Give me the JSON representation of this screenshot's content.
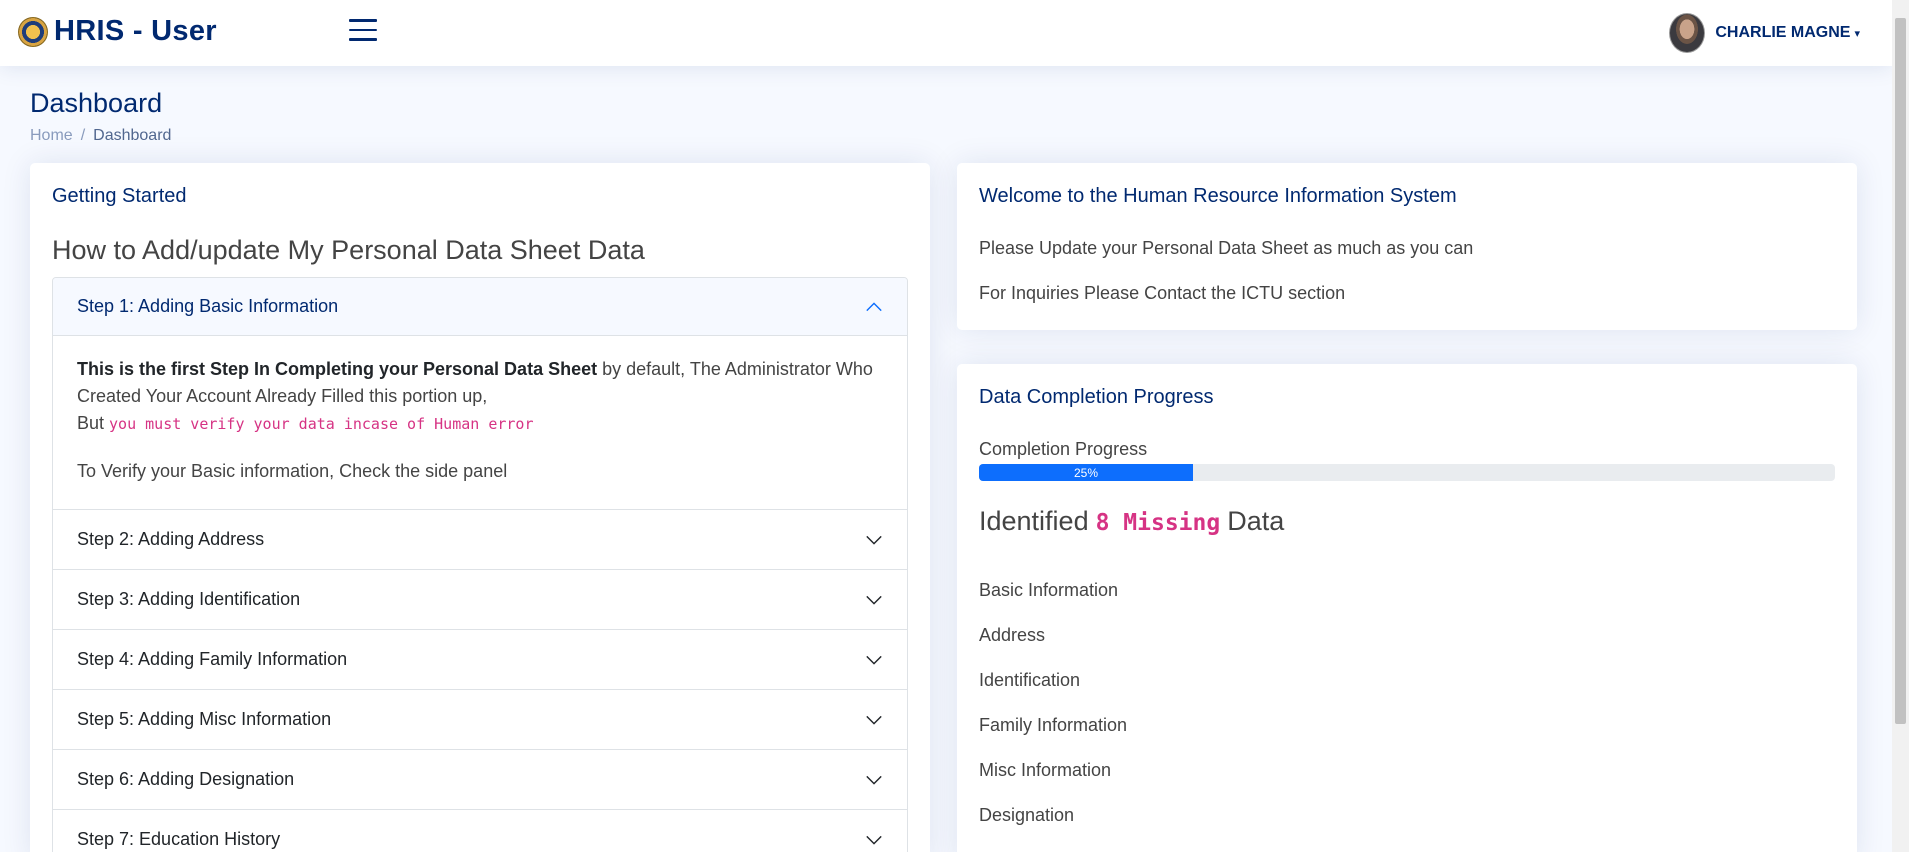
{
  "header": {
    "app_title": "HRIS - User",
    "user_name": "CHARLIE MAGNE",
    "caret": "▾"
  },
  "page": {
    "title": "Dashboard",
    "breadcrumb": {
      "home": "Home",
      "separator": "/",
      "current": "Dashboard"
    }
  },
  "getting_started": {
    "card_title": "Getting Started",
    "heading": "How to Add/update My Personal Data Sheet Data",
    "steps": [
      {
        "label": "Step 1: Adding Basic Information",
        "expanded": true
      },
      {
        "label": "Step 2: Adding Address",
        "expanded": false
      },
      {
        "label": "Step 3: Adding Identification",
        "expanded": false
      },
      {
        "label": "Step 4: Adding Family Information",
        "expanded": false
      },
      {
        "label": "Step 5: Adding Misc Information",
        "expanded": false
      },
      {
        "label": "Step 6: Adding Designation",
        "expanded": false
      },
      {
        "label": "Step 7: Education History",
        "expanded": false
      }
    ],
    "step1_body": {
      "bold": "This is the first Step In Completing your Personal Data Sheet",
      "rest": " by default, The Administrator Who Created Your Account Already Filled this portion up,",
      "but_prefix": "But ",
      "code_text": "you must verify your data incase of Human error",
      "verify_text": "To Verify your Basic information, Check the side panel"
    }
  },
  "welcome": {
    "card_title": "Welcome to the Human Resource Information System",
    "line1": "Please Update your Personal Data Sheet as much as you can",
    "line2": "For Inquiries Please Contact the ICTU section"
  },
  "progress": {
    "card_title": "Data Completion Progress",
    "label": "Completion Progress",
    "percent": 25,
    "percent_text": "25%",
    "identified_prefix": "Identified",
    "missing_code": "8 Missing",
    "identified_suffix": "Data",
    "missing_items": [
      "Basic Information",
      "Address",
      "Identification",
      "Family Information",
      "Misc Information",
      "Designation"
    ]
  },
  "colors": {
    "brand": "#012970",
    "accent": "#0d6efd",
    "code": "#d63384"
  }
}
